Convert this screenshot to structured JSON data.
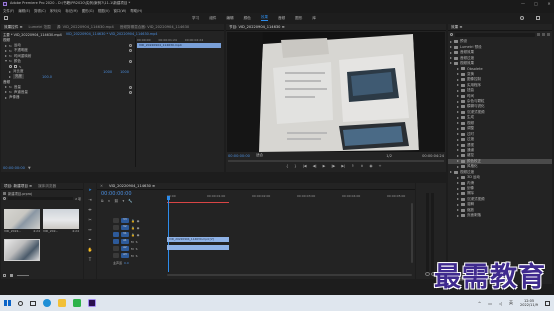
{
  "titlebar": {
    "title": "Adobe Premiere Pro 2020 - D:\\书籍\\PR2020\\实例\\案例7\\11.1\\新建项目 *",
    "app_icon": "premiere-pro-icon"
  },
  "menubar": [
    "文件(F)",
    "编辑(E)",
    "剪辑(C)",
    "序列(S)",
    "标记(M)",
    "图形(G)",
    "视图(V)",
    "窗口(W)",
    "帮助(H)"
  ],
  "workspaces": {
    "items": [
      "学习",
      "组件",
      "编辑",
      "颜色",
      "效果",
      "音频",
      "图形",
      "库"
    ],
    "active": "效果"
  },
  "source_panel": {
    "tabs": [
      "效果控件 ≡",
      "Lumetri 范围",
      "源: VID_20220904_114630.mp4",
      "音频剪辑混合器: VID_20220904_114630"
    ],
    "clip_label": "主要 * VID_20220904_114630.mp4",
    "seq_label": "VID_20220904_114630 * VID_20220904_114630.mp4",
    "mini_times": [
      "00:00:00",
      "00:00:01:24",
      "00:00:02:24"
    ],
    "mini_clip": "VID_20220904_114630.mp4",
    "video_header": "视频",
    "fx_rows": [
      {
        "name": "运动",
        "value": ""
      },
      {
        "name": "不透明度",
        "value": ""
      },
      {
        "name": "时间重映射",
        "value": ""
      },
      {
        "name": "颜色",
        "value": ""
      },
      {
        "name": "亮度",
        "value": ""
      },
      {
        "name": "对比度",
        "value": ""
      },
      {
        "name": "目标颜色",
        "value": "1000"
      },
      {
        "name": "保持光度",
        "value": "100.0"
      }
    ],
    "audio_header": "音频",
    "audio_rows": [
      "音量",
      "声道音量",
      "声像器"
    ],
    "timecode": "00:00:00:00"
  },
  "program_monitor": {
    "title": "节目: VID_20220904_114630 ≡",
    "timecode": "00:00:00:00",
    "fit": "适合",
    "quality": "1/2",
    "duration": "00:00:04:24"
  },
  "effects_panel": {
    "title": "效果 ≡",
    "search_placeholder": "",
    "tree": [
      {
        "label": "预设",
        "indent": 0,
        "type": "folder"
      },
      {
        "label": "Lumetri 预设",
        "indent": 0,
        "type": "folder"
      },
      {
        "label": "音频效果",
        "indent": 0,
        "type": "folder"
      },
      {
        "label": "音频过渡",
        "indent": 0,
        "type": "folder"
      },
      {
        "label": "视频效果",
        "indent": 0,
        "type": "folder"
      },
      {
        "label": "Obsolete",
        "indent": 1,
        "type": "folder"
      },
      {
        "label": "变换",
        "indent": 1,
        "type": "folder"
      },
      {
        "label": "图像控制",
        "indent": 1,
        "type": "folder"
      },
      {
        "label": "实用程序",
        "indent": 1,
        "type": "folder"
      },
      {
        "label": "扭曲",
        "indent": 1,
        "type": "folder"
      },
      {
        "label": "时间",
        "indent": 1,
        "type": "folder"
      },
      {
        "label": "杂色与颗粒",
        "indent": 1,
        "type": "folder"
      },
      {
        "label": "模糊与锐化",
        "indent": 1,
        "type": "folder"
      },
      {
        "label": "沉浸式视频",
        "indent": 1,
        "type": "folder"
      },
      {
        "label": "生成",
        "indent": 1,
        "type": "folder"
      },
      {
        "label": "视频",
        "indent": 1,
        "type": "folder"
      },
      {
        "label": "调整",
        "indent": 1,
        "type": "folder"
      },
      {
        "label": "过时",
        "indent": 1,
        "type": "folder"
      },
      {
        "label": "过渡",
        "indent": 1,
        "type": "folder"
      },
      {
        "label": "透视",
        "indent": 1,
        "type": "folder"
      },
      {
        "label": "通道",
        "indent": 1,
        "type": "folder"
      },
      {
        "label": "键控",
        "indent": 1,
        "type": "folder"
      },
      {
        "label": "颜色校正",
        "indent": 1,
        "type": "folder",
        "selected": true
      },
      {
        "label": "风格化",
        "indent": 1,
        "type": "folder"
      },
      {
        "label": "视频过渡",
        "indent": 0,
        "type": "folder"
      },
      {
        "label": "3D 运动",
        "indent": 1,
        "type": "folder"
      },
      {
        "label": "内滑",
        "indent": 1,
        "type": "folder"
      },
      {
        "label": "划像",
        "indent": 1,
        "type": "folder"
      },
      {
        "label": "擦除",
        "indent": 1,
        "type": "folder"
      },
      {
        "label": "沉浸式视频",
        "indent": 1,
        "type": "folder"
      },
      {
        "label": "溶解",
        "indent": 1,
        "type": "folder"
      },
      {
        "label": "缩放",
        "indent": 1,
        "type": "folder"
      },
      {
        "label": "页面剥落",
        "indent": 1,
        "type": "folder"
      }
    ],
    "base_graphics": "基本图形"
  },
  "project_panel": {
    "tabs": [
      "项目: 新建项目 ≡",
      "媒体浏览器"
    ],
    "project_file": "新建项目.prproj",
    "count": "2 项",
    "items": [
      {
        "name": "VID_2022...",
        "duration": "4:24"
      },
      {
        "name": "VID_202...",
        "duration": "4:24"
      }
    ]
  },
  "timeline": {
    "title": "VID_20220904_114630 ≡",
    "timecode": "00:00:00:00",
    "ruler": [
      "00:00",
      "00:00:01:00",
      "00:00:02:00",
      "00:00:03:00",
      "00:00:04:00",
      "00:00:05:00"
    ],
    "tracks": [
      "V3",
      "V2",
      "V1",
      "A1",
      "A2",
      "A3"
    ],
    "master": "主声道",
    "master_value": "0.0",
    "video_clip": "VID_20220904_114630.mp4 [V]",
    "audio_clip": ""
  },
  "watermark": "最需教育",
  "taskbar": {
    "time": "12:05",
    "date": "2022/11/9",
    "lang": "英"
  },
  "colors": {
    "accent": "#2d8ceb",
    "playhead": "#d94545",
    "video_clip": "#8fb2e6",
    "selected": "#4a4a4a"
  }
}
